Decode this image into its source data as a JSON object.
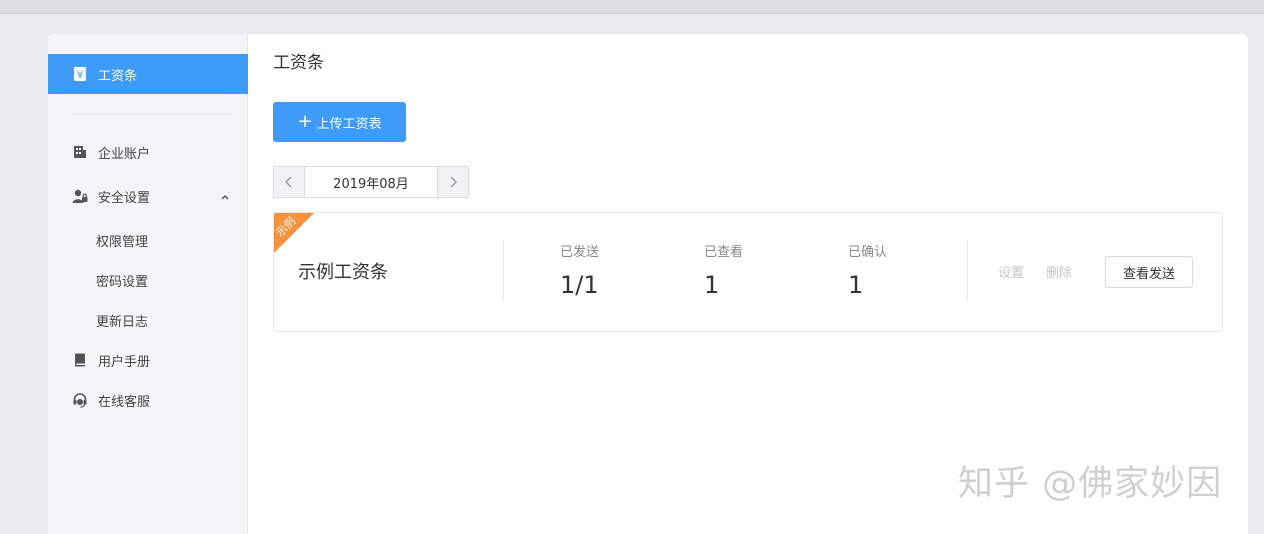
{
  "sidebar": {
    "active": {
      "label": "工资条",
      "icon": "payslip-icon"
    },
    "items": [
      {
        "label": "企业账户",
        "icon": "building-icon"
      },
      {
        "label": "安全设置",
        "icon": "user-lock-icon",
        "expanded": true
      },
      {
        "label": "权限管理"
      },
      {
        "label": "密码设置"
      },
      {
        "label": "更新日志"
      },
      {
        "label": "用户手册",
        "icon": "book-icon"
      },
      {
        "label": "在线客服",
        "icon": "headset-icon"
      }
    ]
  },
  "main": {
    "title": "工资条",
    "upload_button": "上传工资表",
    "month_picker": {
      "value": "2019年08月"
    },
    "card": {
      "ribbon": "示例",
      "name": "示例工资条",
      "stats": [
        {
          "label": "已发送",
          "value": "1/1"
        },
        {
          "label": "已查看",
          "value": "1"
        },
        {
          "label": "已确认",
          "value": "1"
        }
      ],
      "actions": {
        "settings": "设置",
        "delete": "删除",
        "view_send": "查看发送"
      }
    }
  },
  "watermark": "知乎 @佛家妙因",
  "colors": {
    "accent": "#3f9bf8",
    "ribbon": "#f5923e",
    "sidebar_bg": "#f4f5f7"
  }
}
